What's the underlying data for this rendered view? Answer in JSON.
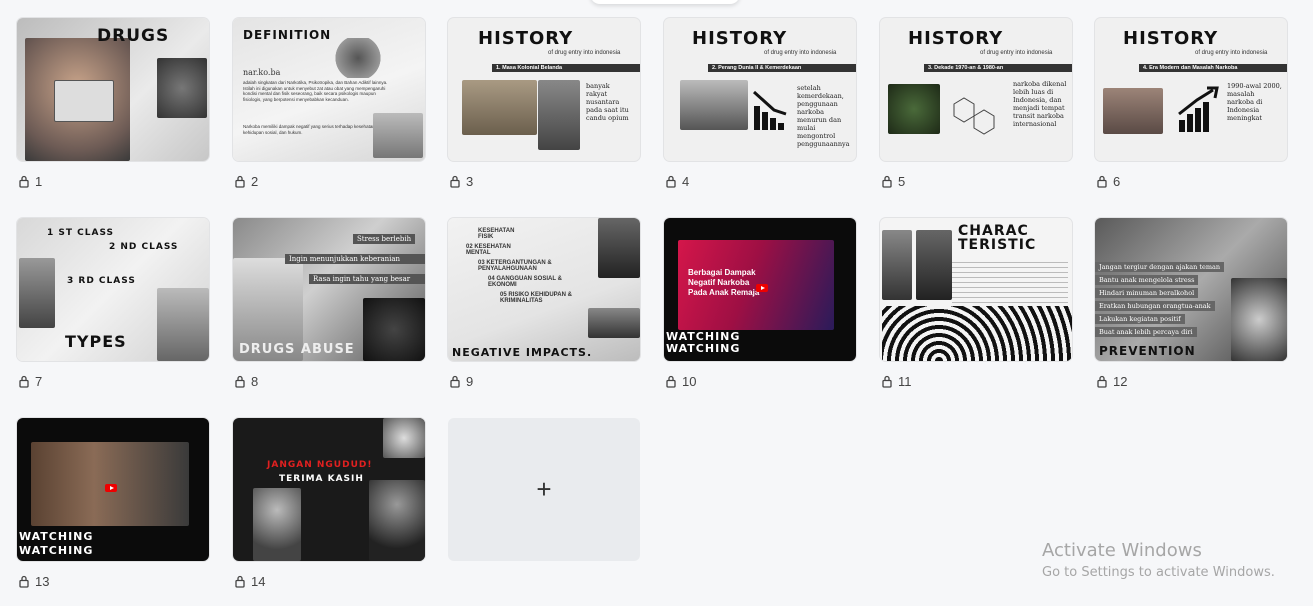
{
  "slides": [
    {
      "number": "1",
      "title": "DRUGS"
    },
    {
      "number": "2",
      "title": "DEFINITION",
      "brand": "nar.ko.ba",
      "para1": "adalah singkatan dari Narkotika, Psikotropika, dan Bahan Adiktif lainnya. Istilah ini digunakan untuk menyebut zat atau obat yang mempengaruhi kondisi mental dan fisik seseorang, baik secara psikologis maupun fisiologis, yang berpotensi menyebabkan kecanduan.",
      "para2": "Narkoba memiliki dampak negatif yang serius terhadap kesehatan, kehidupan sosial, dan hukum."
    },
    {
      "number": "3",
      "title": "HISTORY",
      "subtitle": "of drug entry into indonesia",
      "bar": "1.   Masa Kolonial Belanda",
      "text": "banyak rakyat nusantara pada saat itu candu opium"
    },
    {
      "number": "4",
      "title": "HISTORY",
      "subtitle": "of drug entry into indonesia",
      "bar": "2. Perang Dunia II & Kemerdekaan",
      "text": "setelah kemerdekaan, penggunaan narkoba menurun dan mulai mengontrol penggunaannya"
    },
    {
      "number": "5",
      "title": "HISTORY",
      "subtitle": "of drug entry into indonesia",
      "bar": "3. Dekade 1970-an & 1980-an",
      "text": "narkoba dikenal lebih luas di Indonesia, dan menjadi tempat transit narkoba internasional"
    },
    {
      "number": "6",
      "title": "HISTORY",
      "subtitle": "of drug entry into indonesia",
      "bar": "4. Era Modern dan Masalah Narkoba",
      "text": "1990-awal 2000, masalah narkoba di Indonesia meningkat"
    },
    {
      "number": "7",
      "title": "TYPES",
      "classes": [
        "1 ST CLASS",
        "2 ND CLASS",
        "3 RD CLASS"
      ]
    },
    {
      "number": "8",
      "title": "DRUGS ABUSE",
      "reasons": [
        "Stress berlebih",
        "Ingin menunjukkan keberanian",
        "Rasa ingin tahu yang besar"
      ]
    },
    {
      "number": "9",
      "title": "NEGATIVE IMPACTS.",
      "items": [
        "KESEHATAN FISIK",
        "02 KESEHATAN MENTAL",
        "03 KETERGANTUNGAN & PENYALAHGUNAAN",
        "04 GANGGUAN SOSIAL & EKONOMI",
        "05 RISIKO KEHIDUPAN & KRIMINALITAS"
      ]
    },
    {
      "number": "10",
      "title": "WATCHING",
      "video_text": "Berbagai Dampak Negatif Narkoba Pada Anak Remaja"
    },
    {
      "number": "11",
      "title": "CHARAC TERISTIC"
    },
    {
      "number": "12",
      "title": "PREVENTION",
      "tips": [
        "Jangan tergiur dengan ajakan teman",
        "Bantu anak mengelola stress",
        "Hindari minuman beralkohol",
        "Eratkan hubungan orangtua-anak",
        "Lakukan kegiatan positif",
        "Buat anak lebih percaya diri"
      ]
    },
    {
      "number": "13",
      "title": "WATCHING"
    },
    {
      "number": "14",
      "banner": "JANGAN NGUDUD!",
      "title": "TERIMA KASIH"
    }
  ],
  "add_slide_label": "+",
  "watermark": {
    "title": "Activate Windows",
    "subtitle": "Go to Settings to activate Windows."
  }
}
